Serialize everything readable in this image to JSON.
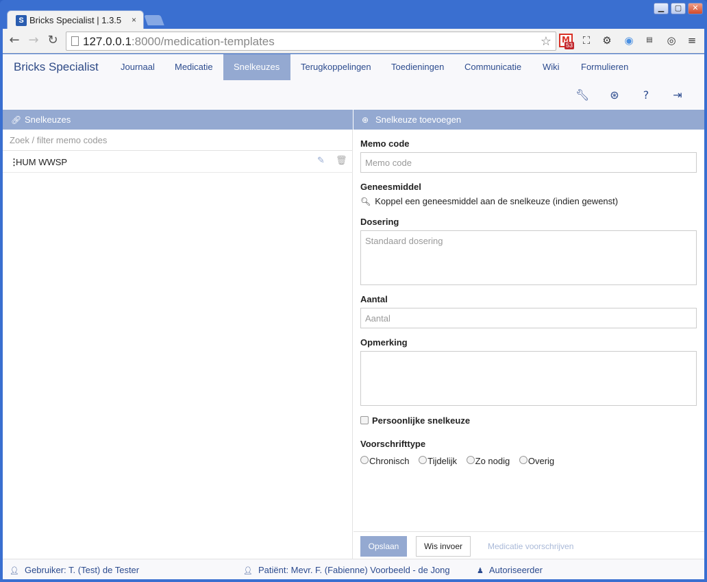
{
  "browser": {
    "tab_title": "Bricks Specialist | 1.3.5",
    "tab_close": "×",
    "favicon_letter": "S",
    "url_host": "127.0.0.1",
    "url_rest": ":8000/medication-templates",
    "gmail_badge": "53"
  },
  "app": {
    "brand": "Bricks Specialist",
    "nav": [
      {
        "label": "Journaal",
        "active": false
      },
      {
        "label": "Medicatie",
        "active": false
      },
      {
        "label": "Snelkeuzes",
        "active": true
      },
      {
        "label": "Terugkoppelingen",
        "active": false
      },
      {
        "label": "Toedieningen",
        "active": false
      },
      {
        "label": "Communicatie",
        "active": false
      },
      {
        "label": "Wiki",
        "active": false
      },
      {
        "label": "Formulieren",
        "active": false
      }
    ],
    "accent": "#94a9d1",
    "nav_color": "#2c4b8e"
  },
  "left_panel": {
    "title": "Snelkeuzes",
    "filter_placeholder": "Zoek / filter memo codes",
    "items": [
      {
        "code": "HUM WWSP"
      }
    ]
  },
  "right_panel": {
    "title": "Snelkeuze toevoegen",
    "memo_label": "Memo code",
    "memo_placeholder": "Memo code",
    "drug_label": "Geneesmiddel",
    "drug_link": "Koppel een geneesmiddel aan de snelkeuze (indien gewenst)",
    "dosing_label": "Dosering",
    "dosing_placeholder": "Standaard dosering",
    "amount_label": "Aantal",
    "amount_placeholder": "Aantal",
    "remark_label": "Opmerking",
    "remark_placeholder": "",
    "personal_label": "Persoonlijke snelkeuze",
    "prescription_type_label": "Voorschrifttype",
    "prescription_types": [
      "Chronisch",
      "Tijdelijk",
      "Zo nodig",
      "Overig"
    ],
    "save_button": "Opslaan",
    "clear_button": "Wis invoer",
    "prescribe_link": "Medicatie voorschrijven"
  },
  "status": {
    "user": "Gebruiker: T. (Test) de Tester",
    "patient": "Patiënt: Mevr. F. (Fabienne) Voorbeeld - de Jong",
    "role": "Autoriseerder"
  }
}
